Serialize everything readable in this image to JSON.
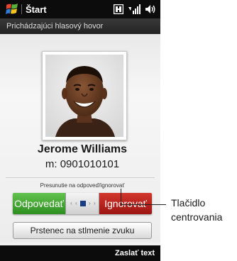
{
  "status_bar": {
    "start_label": "Štart",
    "icons": [
      "windows-flag-icon",
      "network-icon",
      "signal-icon",
      "volume-icon"
    ]
  },
  "title_bar": {
    "title": "Prichádzajúci hlasový hovor"
  },
  "caller": {
    "name": "Jerome Williams",
    "number": "m: 0901010101"
  },
  "slider": {
    "hint": "Presunutie na odpoveď/ignorovať",
    "answer_label": "Odpovedať",
    "ignore_label": "Ignorovať",
    "answer_color": "#3fa831",
    "ignore_color": "#c0241d"
  },
  "ring_mute_button": {
    "label": "Prstenec na stlmenie zvuku"
  },
  "softkeys": {
    "right": "Zaslať text"
  },
  "callout": {
    "line1": "Tlačidlo",
    "line2": "centrovania"
  }
}
